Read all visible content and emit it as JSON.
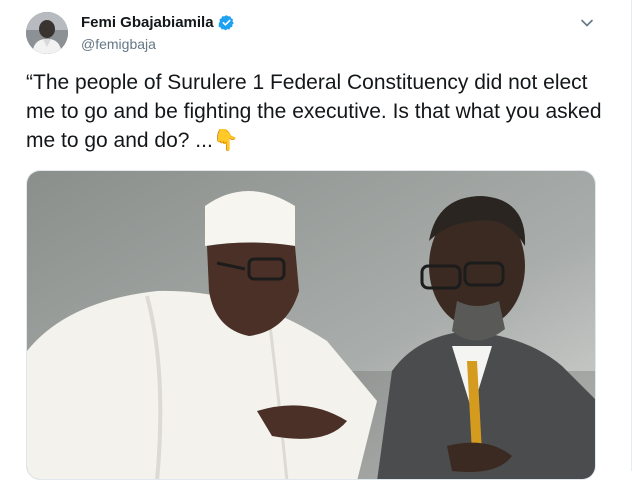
{
  "tweet": {
    "display_name": "Femi Gbajabiamila",
    "handle": "@femigbaja",
    "text": "“The people of Surulere 1 Federal Constituency did not elect me to go and be fighting the executive. Is that what you asked me to go and do? ...👇"
  },
  "icons": {
    "verified": "verified-badge-icon",
    "caret": "chevron-down-icon"
  },
  "colors": {
    "verified_blue": "#1da1f2",
    "text": "#14171a",
    "secondary": "#657786"
  }
}
